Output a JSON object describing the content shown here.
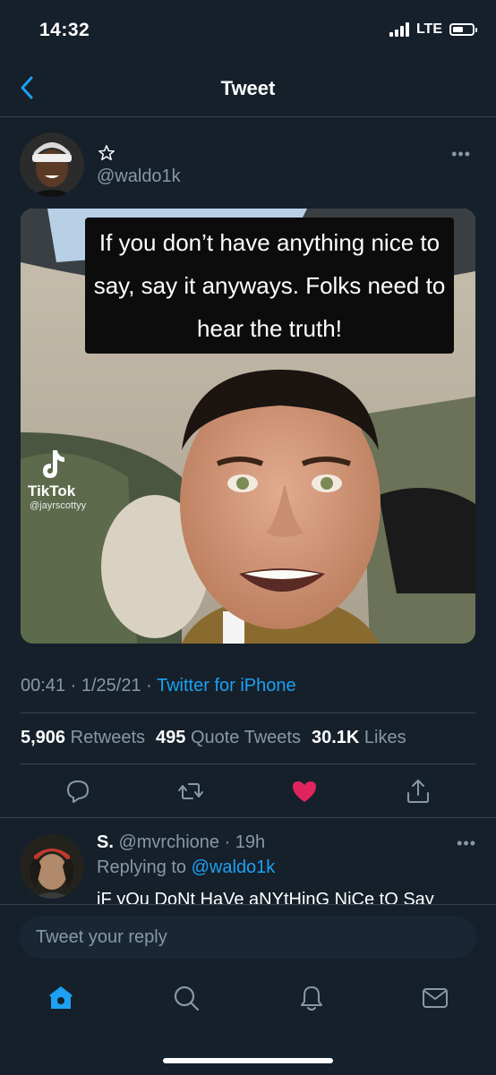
{
  "status_bar": {
    "time": "14:32",
    "network": "LTE",
    "battery_level": 0.55
  },
  "header": {
    "title": "Tweet",
    "back_icon": "chevron-left-icon"
  },
  "tweet": {
    "handle": "@waldo1k",
    "display_icon": "star-outline-icon",
    "more_icon": "more-horizontal-icon",
    "media": {
      "caption": "If you don’t have anything nice to say, say it anyways. Folks need to hear the truth!",
      "watermark_brand": "TikTok",
      "watermark_user": "@jayrscottyy"
    },
    "meta": {
      "time": "00:41",
      "sep1": " · ",
      "date": "1/25/21",
      "sep2": " · ",
      "source": "Twitter for iPhone"
    },
    "stats": {
      "retweets_count": "5,906",
      "retweets_label": "Retweets",
      "quotes_count": "495",
      "quotes_label": "Quote Tweets",
      "likes_count": "30.1K",
      "likes_label": "Likes"
    },
    "actions": [
      "reply-icon",
      "retweet-icon",
      "heart-filled-icon",
      "share-icon"
    ]
  },
  "reply": {
    "name": "S.",
    "handle": "@mvrchione",
    "time": "· 19h",
    "replying_prefix": "Replying to",
    "replying_handle": "@waldo1k",
    "text": "iF yOu DoNt HaVe aNYtHinG NiCe tO Say"
  },
  "compose": {
    "placeholder": "Tweet your reply"
  },
  "tabbar": {
    "items": [
      "home-icon",
      "search-icon",
      "notifications-icon",
      "messages-icon"
    ]
  },
  "colors": {
    "background": "#15202b",
    "accent": "#1da1f2",
    "like": "#e0245e",
    "muted_text": "#8899a6",
    "divider": "#38444d"
  }
}
